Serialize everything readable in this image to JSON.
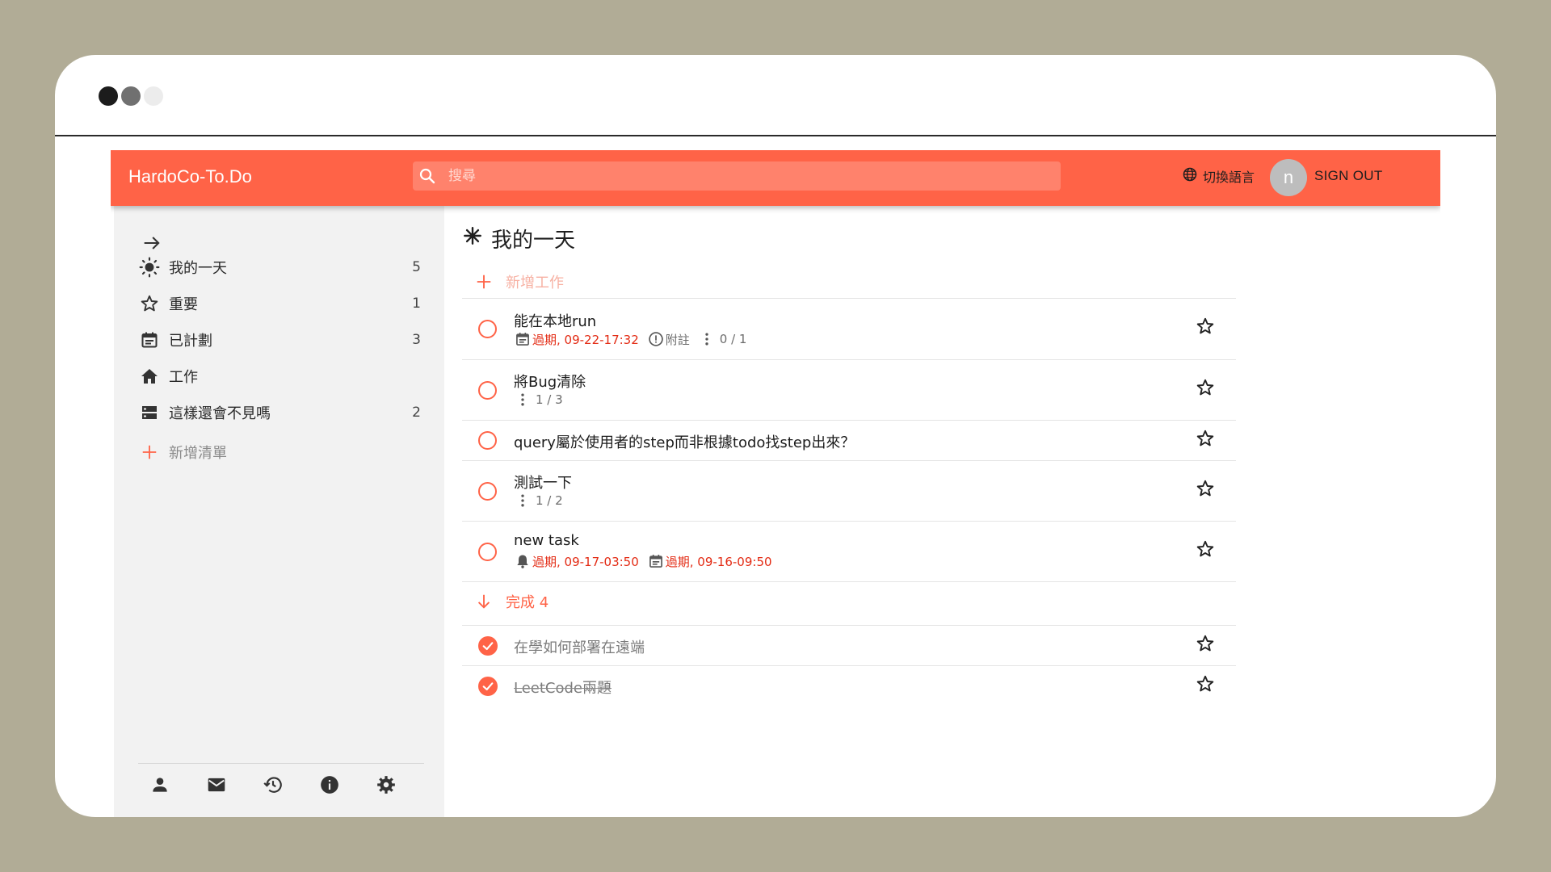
{
  "app": {
    "brand": "HardoCo-To.Do",
    "search_placeholder": "搜尋",
    "language_label": "切換語言",
    "avatar_initial": "n",
    "sign_out_label": "SIGN OUT",
    "accent_color": "#ff6347"
  },
  "sidebar": {
    "items": [
      {
        "label": "我的一天",
        "count": "5",
        "icon": "sun-icon"
      },
      {
        "label": "重要",
        "count": "1",
        "icon": "star-icon"
      },
      {
        "label": "已計劃",
        "count": "3",
        "icon": "calendar-icon"
      },
      {
        "label": "工作",
        "count": "",
        "icon": "home-icon"
      },
      {
        "label": "這樣還會不見嗎",
        "count": "2",
        "icon": "list-icon"
      }
    ],
    "add_list_label": "新增清單",
    "footer_icons": [
      "person-icon",
      "mail-icon",
      "history-icon",
      "info-icon",
      "settings-icon"
    ]
  },
  "main": {
    "title": "我的一天",
    "add_task_label": "新增工作",
    "tasks": [
      {
        "title": "能在本地run",
        "due": "過期, 09-22-17:32",
        "note_label": "附註",
        "steps": "0 / 1"
      },
      {
        "title": "將Bug清除",
        "steps": "1 / 3"
      },
      {
        "title": "query屬於使用者的step而非根據todo找step出來？"
      },
      {
        "title": "測試一下",
        "steps": "1 / 2"
      },
      {
        "title": "new task",
        "reminder": "過期, 09-17-03:50",
        "due": "過期, 09-16-09:50"
      }
    ],
    "completed_label": "完成 4",
    "completed_tasks": [
      {
        "title": "在學如何部署在遠端"
      },
      {
        "title": "LeetCode兩題"
      }
    ]
  }
}
